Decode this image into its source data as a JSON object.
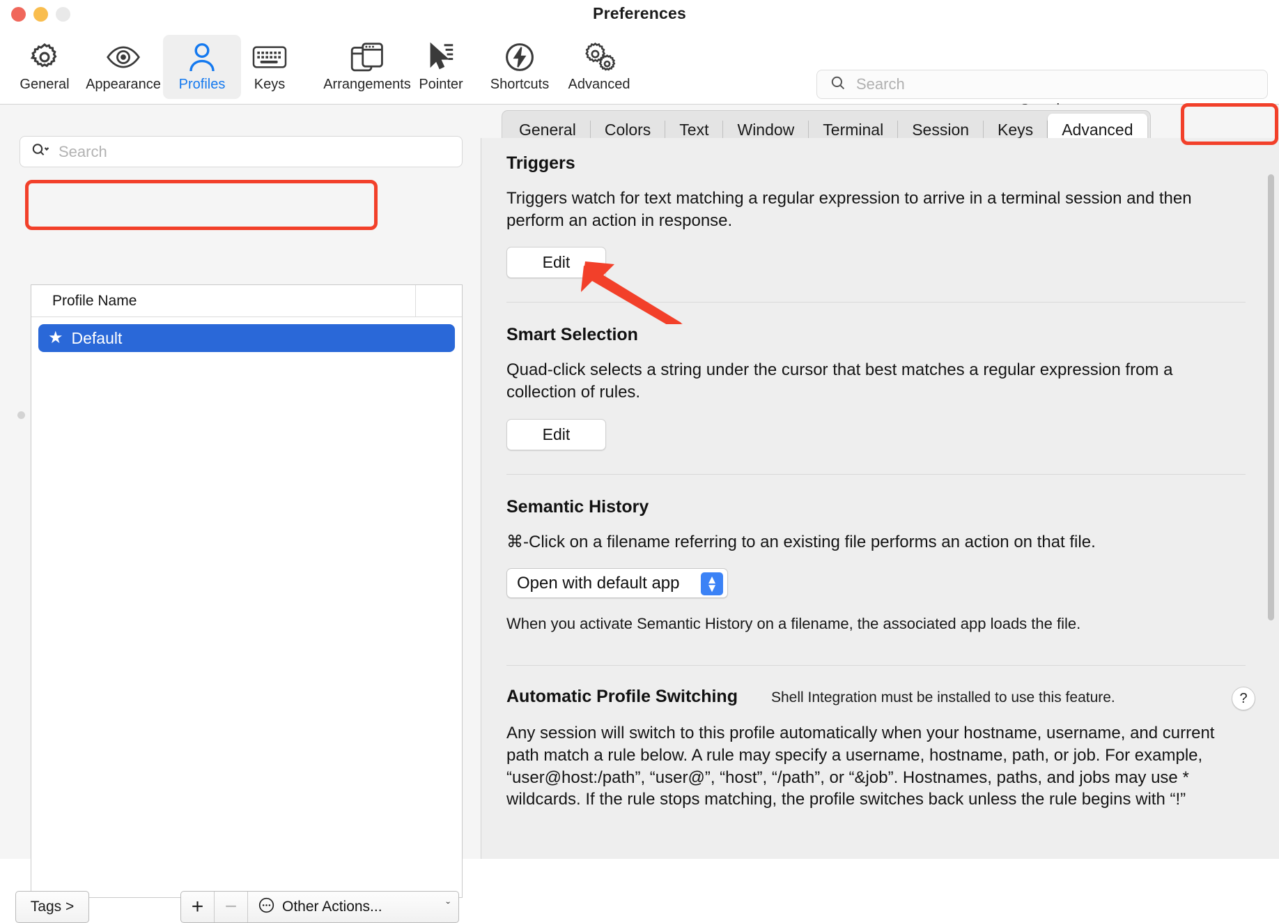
{
  "window": {
    "title": "Preferences",
    "traffic_lights": [
      "close",
      "minimize",
      "zoom"
    ]
  },
  "toolbar": {
    "items": [
      {
        "label": "General",
        "icon": "gear-icon",
        "selected": false
      },
      {
        "label": "Appearance",
        "icon": "eye-icon",
        "selected": false
      },
      {
        "label": "Profiles",
        "icon": "person-icon",
        "selected": true
      },
      {
        "label": "Keys",
        "icon": "keyboard-icon",
        "selected": false
      },
      {
        "label": "Arrangements",
        "icon": "windows-icon",
        "selected": false
      },
      {
        "label": "Pointer",
        "icon": "cursor-icon",
        "selected": false
      },
      {
        "label": "Shortcuts",
        "icon": "bolt-circle-icon",
        "selected": false
      },
      {
        "label": "Advanced",
        "icon": "two-gears-icon",
        "selected": false
      }
    ],
    "search": {
      "placeholder": "Search",
      "value": "",
      "label": "Search"
    }
  },
  "sidebar": {
    "search": {
      "placeholder": "Search",
      "value": ""
    },
    "table": {
      "column_header": "Profile Name",
      "rows": [
        {
          "name": "Default",
          "starred": true,
          "selected": true
        }
      ]
    },
    "bottom_bar": {
      "tags_label": "Tags >",
      "add_label": "+",
      "remove_label": "−",
      "other_actions_label": "Other Actions...",
      "other_actions_icon": "ellipsis-circle-icon",
      "chevron": "ˇ"
    }
  },
  "tabs": [
    {
      "label": "General",
      "selected": false
    },
    {
      "label": "Colors",
      "selected": false
    },
    {
      "label": "Text",
      "selected": false
    },
    {
      "label": "Window",
      "selected": false
    },
    {
      "label": "Terminal",
      "selected": false
    },
    {
      "label": "Session",
      "selected": false
    },
    {
      "label": "Keys",
      "selected": false
    },
    {
      "label": "Advanced",
      "selected": true
    }
  ],
  "content": {
    "triggers": {
      "title": "Triggers",
      "description": "Triggers watch for text matching a regular expression to arrive in a terminal session and then perform an action in response.",
      "edit_label": "Edit"
    },
    "smart_selection": {
      "title": "Smart Selection",
      "description": "Quad-click selects a string under the cursor that best matches a regular expression from a collection of rules.",
      "edit_label": "Edit"
    },
    "semantic_history": {
      "title": "Semantic History",
      "description": "⌘-Click on a filename referring to an existing file performs an action on that file.",
      "select_value": "Open with default app",
      "helper": "When you activate Semantic History on a filename, the associated app loads the file."
    },
    "automatic_profile_switching": {
      "title": "Automatic Profile Switching",
      "note": "Shell Integration must be installed to use this feature.",
      "help_label": "?",
      "description": "Any session will switch to this profile automatically when your hostname, username, and current path match a rule below. A rule may specify a username, hostname, path, or job. For example, “user@host:/path”, “user@”, “host”, “/path”, or “&job”. Hostnames, paths, and jobs may use * wildcards. If the rule stops matching, the profile switches back unless the rule begins with “!”"
    }
  },
  "annotations": {
    "color": "#f2402a",
    "highlight_advanced_tab": true,
    "highlight_default_profile_row": true,
    "arrow_points_to": "triggers-edit-button"
  }
}
